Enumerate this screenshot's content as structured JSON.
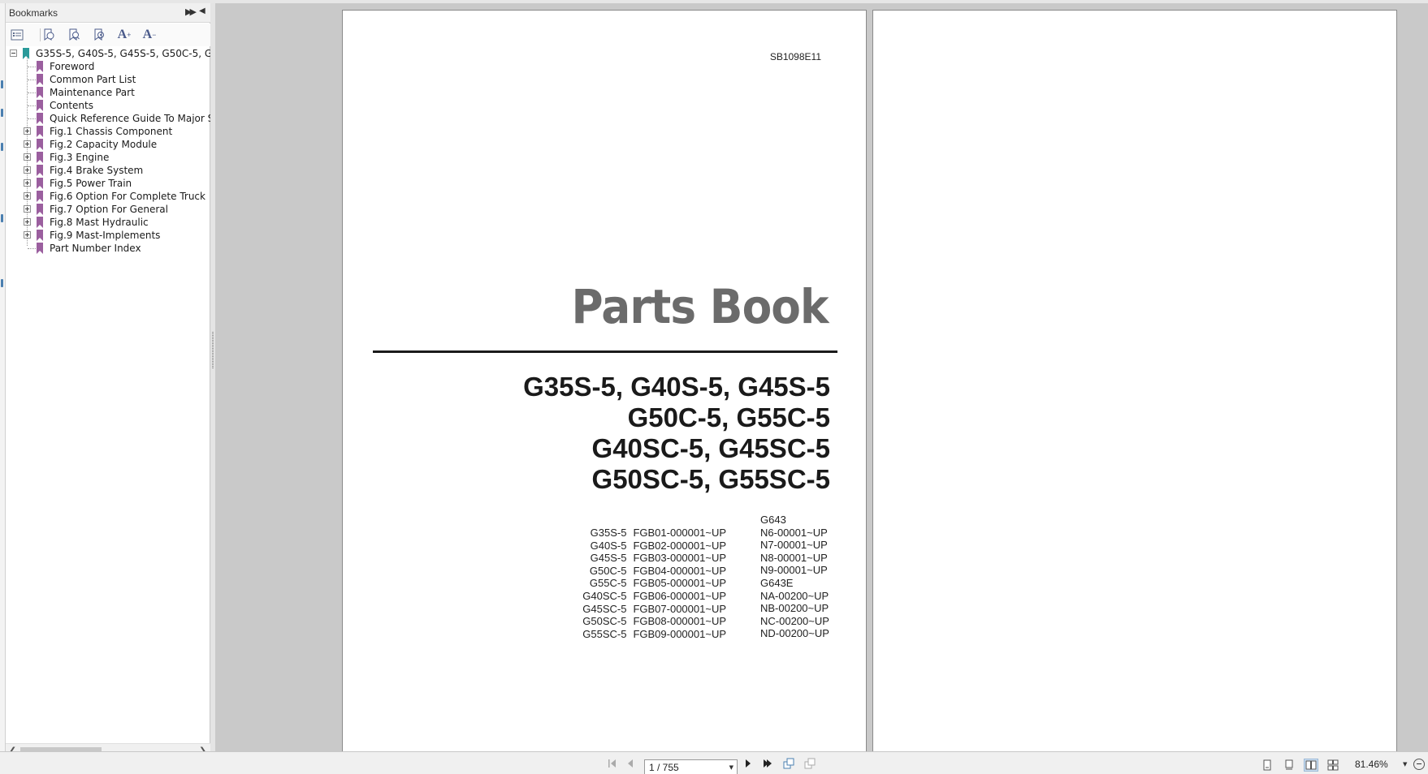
{
  "bookmarks_panel": {
    "title": "Bookmarks",
    "tree": {
      "root": {
        "label": "G35S-5, G40S-5, G45S-5, G50C-5, G5"
      },
      "items": [
        {
          "label": "Foreword",
          "expandable": false
        },
        {
          "label": "Common Part List",
          "expandable": false
        },
        {
          "label": "Maintenance Part",
          "expandable": false
        },
        {
          "label": "Contents",
          "expandable": false
        },
        {
          "label": "Quick Reference Guide To Major S",
          "expandable": false
        },
        {
          "label": "Fig.1 Chassis Component",
          "expandable": true
        },
        {
          "label": "Fig.2 Capacity Module",
          "expandable": true
        },
        {
          "label": "Fig.3 Engine",
          "expandable": true
        },
        {
          "label": "Fig.4 Brake System",
          "expandable": true
        },
        {
          "label": "Fig.5 Power Train",
          "expandable": true
        },
        {
          "label": "Fig.6 Option For Complete Truck",
          "expandable": true
        },
        {
          "label": "Fig.7 Option For General",
          "expandable": true
        },
        {
          "label": "Fig.8 Mast Hydraulic",
          "expandable": true
        },
        {
          "label": "Fig.9 Mast-Implements",
          "expandable": true
        },
        {
          "label": "Part Number Index",
          "expandable": false
        }
      ]
    },
    "toolbar": {
      "enlarge_text": "A",
      "shrink_text": "A"
    }
  },
  "document": {
    "code": "SB1098E11",
    "title": "Parts Book",
    "models": [
      "G35S-5, G40S-5, G45S-5",
      "G50C-5, G55C-5",
      "G40SC-5, G45SC-5",
      "G50SC-5, G55SC-5"
    ],
    "serials": [
      {
        "model": "G35S-5",
        "serial": "FGB01-000001~UP"
      },
      {
        "model": "G40S-5",
        "serial": "FGB02-000001~UP"
      },
      {
        "model": "G45S-5",
        "serial": "FGB03-000001~UP"
      },
      {
        "model": "G50C-5",
        "serial": "FGB04-000001~UP"
      },
      {
        "model": "G55C-5",
        "serial": "FGB05-000001~UP"
      },
      {
        "model": "G40SC-5",
        "serial": "FGB06-000001~UP"
      },
      {
        "model": "G45SC-5",
        "serial": "FGB07-000001~UP"
      },
      {
        "model": "G50SC-5",
        "serial": "FGB08-000001~UP"
      },
      {
        "model": "G55SC-5",
        "serial": "FGB09-000001~UP"
      }
    ],
    "engines": [
      "G643",
      "N6-00001~UP",
      "N7-00001~UP",
      "N8-00001~UP",
      "N9-00001~UP",
      "G643E",
      "NA-00200~UP",
      "NB-00200~UP",
      "NC-00200~UP",
      "ND-00200~UP"
    ]
  },
  "statusbar": {
    "page_indicator": "1 / 755",
    "zoom": "81.46%"
  },
  "colors": {
    "bookmark_purple": "#9b5f9f",
    "bookmark_root_teal": "#2a9a9a",
    "viewer_bg": "#c9c9c9",
    "title_gray": "#6b6b6b"
  }
}
